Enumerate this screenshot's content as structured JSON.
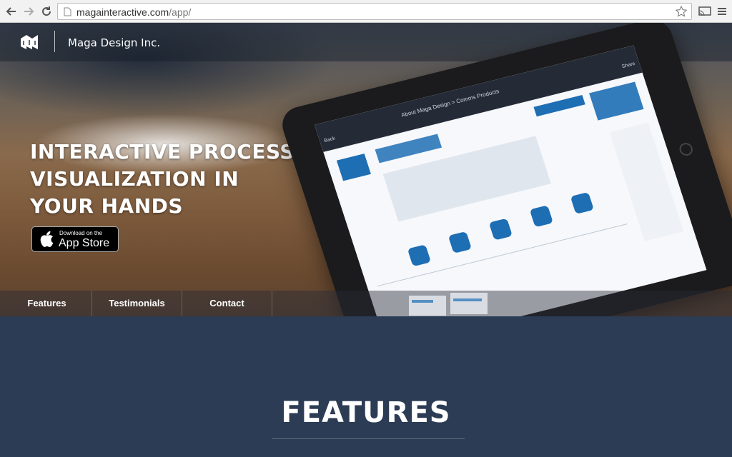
{
  "browser": {
    "url_host": "magainteractive.com",
    "url_path": "/app/",
    "icons": [
      "back-arrow-icon",
      "forward-arrow-icon",
      "reload-icon",
      "page-icon",
      "star-icon",
      "cast-icon",
      "menu-icon"
    ]
  },
  "header": {
    "brand": "Maga Design Inc.",
    "logo_icon": "maga-logo-icon"
  },
  "hero": {
    "headline_1": "INTERACTIVE PROCESS",
    "headline_2": "VISUALIZATION IN",
    "headline_3": "YOUR HANDS",
    "appstore_small": "Download on the",
    "appstore_big": "App Store",
    "appstore_icon": "apple-icon"
  },
  "tablet": {
    "title": "About Maga Design > Comms Products",
    "back": "Back",
    "share": "Share"
  },
  "nav": {
    "tabs": [
      "Features",
      "Testimonials",
      "Contact"
    ]
  },
  "features": {
    "title": "FEATURES"
  },
  "colors": {
    "page_bg": "#2c3c54",
    "accent_blue": "#1e6eb4"
  }
}
